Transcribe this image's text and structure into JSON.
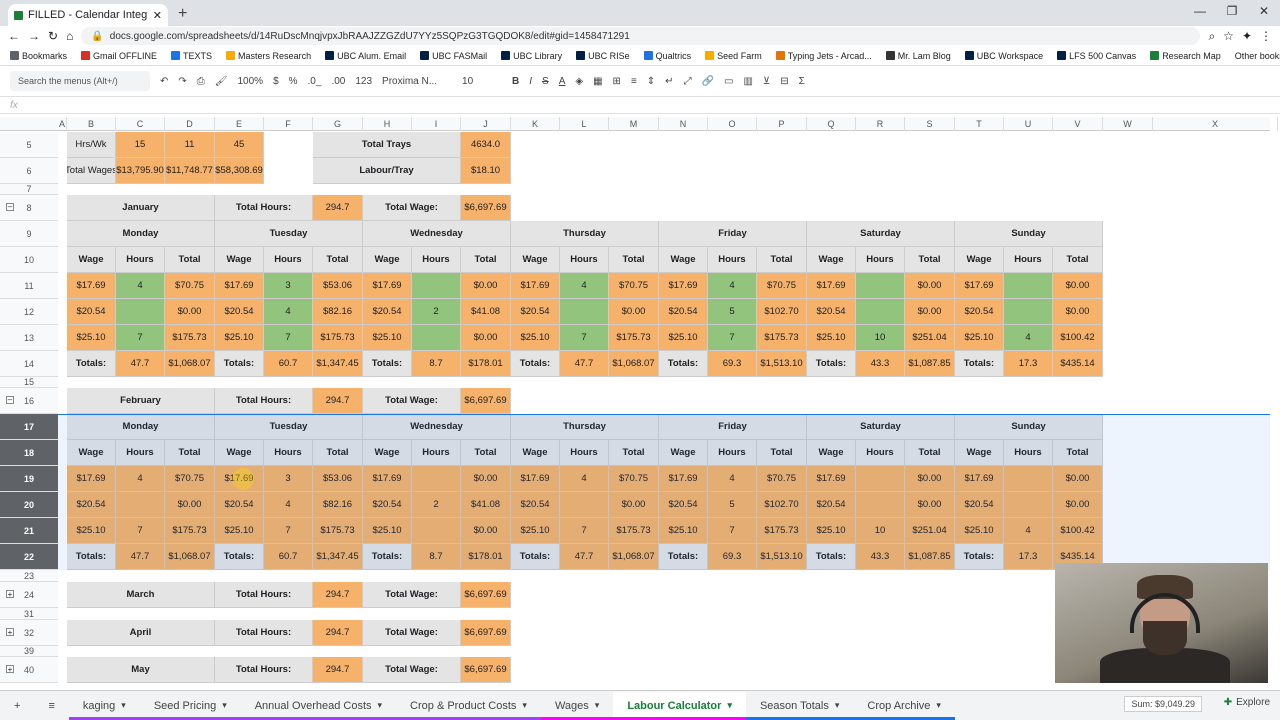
{
  "browser": {
    "tab_title": "FILLED - Calendar Integration - B",
    "url": "docs.google.com/spreadsheets/d/14RuDscMnqjvpxJbRAAJZZGZdU7YYz5SQPzG3TGQDOK8/edit#gid=1458471291"
  },
  "bookmarks": [
    {
      "label": "Bookmarks",
      "color": "#5f6368"
    },
    {
      "label": "Gmail OFFLINE",
      "color": "#d93025"
    },
    {
      "label": "TEXTS",
      "color": "#1a73e8"
    },
    {
      "label": "Masters Research",
      "color": "#f9ab00"
    },
    {
      "label": "UBC Alum. Email",
      "color": "#002145"
    },
    {
      "label": "UBC FASMail",
      "color": "#002145"
    },
    {
      "label": "UBC Library",
      "color": "#002145"
    },
    {
      "label": "UBC RISe",
      "color": "#002145"
    },
    {
      "label": "Qualtrics",
      "color": "#1a73e8"
    },
    {
      "label": "Seed Farm",
      "color": "#f9ab00"
    },
    {
      "label": "Typing Jets - Arcad...",
      "color": "#e37400"
    },
    {
      "label": "Mr. Lam Blog",
      "color": "#333333"
    },
    {
      "label": "UBC Workspace",
      "color": "#002145"
    },
    {
      "label": "LFS 500 Canvas",
      "color": "#002145"
    },
    {
      "label": "Research Map",
      "color": "#188038"
    }
  ],
  "other_bookmarks": "Other bookmarks",
  "toolbar": {
    "search": "Search the menus (Alt+/)",
    "zoom": "100%",
    "currency": "$",
    "percent": "%",
    "dec0": ".0_",
    "dec00": ".00",
    "fmt123": "123",
    "font": "Proxima N...",
    "size": "10",
    "bold": "B",
    "italic": "I",
    "strike": "S",
    "underline": "A"
  },
  "fx": "fx",
  "columns": [
    "A",
    "B",
    "C",
    "D",
    "E",
    "F",
    "G",
    "H",
    "I",
    "J",
    "K",
    "L",
    "M",
    "N",
    "O",
    "P",
    "Q",
    "R",
    "S",
    "T",
    "U",
    "V",
    "W",
    "X"
  ],
  "rows": [
    "5",
    "6",
    "7",
    "8",
    "9",
    "10",
    "11",
    "12",
    "13",
    "14",
    "15",
    "16",
    "17",
    "18",
    "19",
    "20",
    "21",
    "22",
    "23",
    "24",
    "31",
    "32",
    "39",
    "40"
  ],
  "summary": {
    "hrs_label": "Hrs/Wk",
    "hrs": [
      "15",
      "11",
      "45"
    ],
    "wages_label": "Total Wages",
    "wages": [
      "$13,795.90",
      "$11,748.77",
      "$58,308.69"
    ],
    "trays_label": "Total Trays",
    "trays": "4634.0",
    "lpt_label": "Labour/Tray",
    "lpt": "$18.10"
  },
  "labels": {
    "total_hours": "Total Hours:",
    "total_wage": "Total Wage:",
    "wage": "Wage",
    "hours": "Hours",
    "total": "Total",
    "totals": "Totals:"
  },
  "days": [
    "Monday",
    "Tuesday",
    "Wednesday",
    "Thursday",
    "Friday",
    "Saturday",
    "Sunday"
  ],
  "months": [
    {
      "name": "January",
      "hours": "294.7",
      "wage": "$6,697.69"
    },
    {
      "name": "February",
      "hours": "294.7",
      "wage": "$6,697.69"
    },
    {
      "name": "March",
      "hours": "294.7",
      "wage": "$6,697.69"
    },
    {
      "name": "April",
      "hours": "294.7",
      "wage": "$6,697.69"
    },
    {
      "name": "May",
      "hours": "294.7",
      "wage": "$6,697.69"
    }
  ],
  "week_rows": [
    [
      [
        "$17.69",
        "4",
        "$70.75"
      ],
      [
        "$17.69",
        "3",
        "$53.06"
      ],
      [
        "$17.69",
        "",
        "$0.00"
      ],
      [
        "$17.69",
        "4",
        "$70.75"
      ],
      [
        "$17.69",
        "4",
        "$70.75"
      ],
      [
        "$17.69",
        "",
        "$0.00"
      ],
      [
        "$17.69",
        "",
        "$0.00"
      ]
    ],
    [
      [
        "$20.54",
        "",
        "$0.00"
      ],
      [
        "$20.54",
        "4",
        "$82.16"
      ],
      [
        "$20.54",
        "2",
        "$41.08"
      ],
      [
        "$20.54",
        "",
        "$0.00"
      ],
      [
        "$20.54",
        "5",
        "$102.70"
      ],
      [
        "$20.54",
        "",
        "$0.00"
      ],
      [
        "$20.54",
        "",
        "$0.00"
      ]
    ],
    [
      [
        "$25.10",
        "7",
        "$175.73"
      ],
      [
        "$25.10",
        "7",
        "$175.73"
      ],
      [
        "$25.10",
        "",
        "$0.00"
      ],
      [
        "$25.10",
        "7",
        "$175.73"
      ],
      [
        "$25.10",
        "7",
        "$175.73"
      ],
      [
        "$25.10",
        "10",
        "$251.04"
      ],
      [
        "$25.10",
        "4",
        "$100.42"
      ]
    ]
  ],
  "week_totals": [
    [
      "47.7",
      "$1,068.07"
    ],
    [
      "60.7",
      "$1,347.45"
    ],
    [
      "8.7",
      "$178.01"
    ],
    [
      "47.7",
      "$1,068.07"
    ],
    [
      "69.3",
      "$1,513.10"
    ],
    [
      "43.3",
      "$1,087.85"
    ],
    [
      "17.3",
      "$435.14"
    ]
  ],
  "sheet_tabs": [
    {
      "label": "kaging",
      "color": "#a142f4"
    },
    {
      "label": "Seed Pricing",
      "color": "#a142f4"
    },
    {
      "label": "Annual Overhead Costs",
      "color": "#a142f4"
    },
    {
      "label": "Crop & Product Costs",
      "color": "#a142f4"
    },
    {
      "label": "Wages",
      "color": "#ff00ff"
    },
    {
      "label": "Labour Calculator",
      "color": "#ff00ff"
    },
    {
      "label": "Season Totals",
      "color": "#1a73e8"
    },
    {
      "label": "Crop Archive",
      "color": "#1a73e8"
    }
  ],
  "status": {
    "sum": "Sum: $9,049.29",
    "explore": "Explore"
  }
}
